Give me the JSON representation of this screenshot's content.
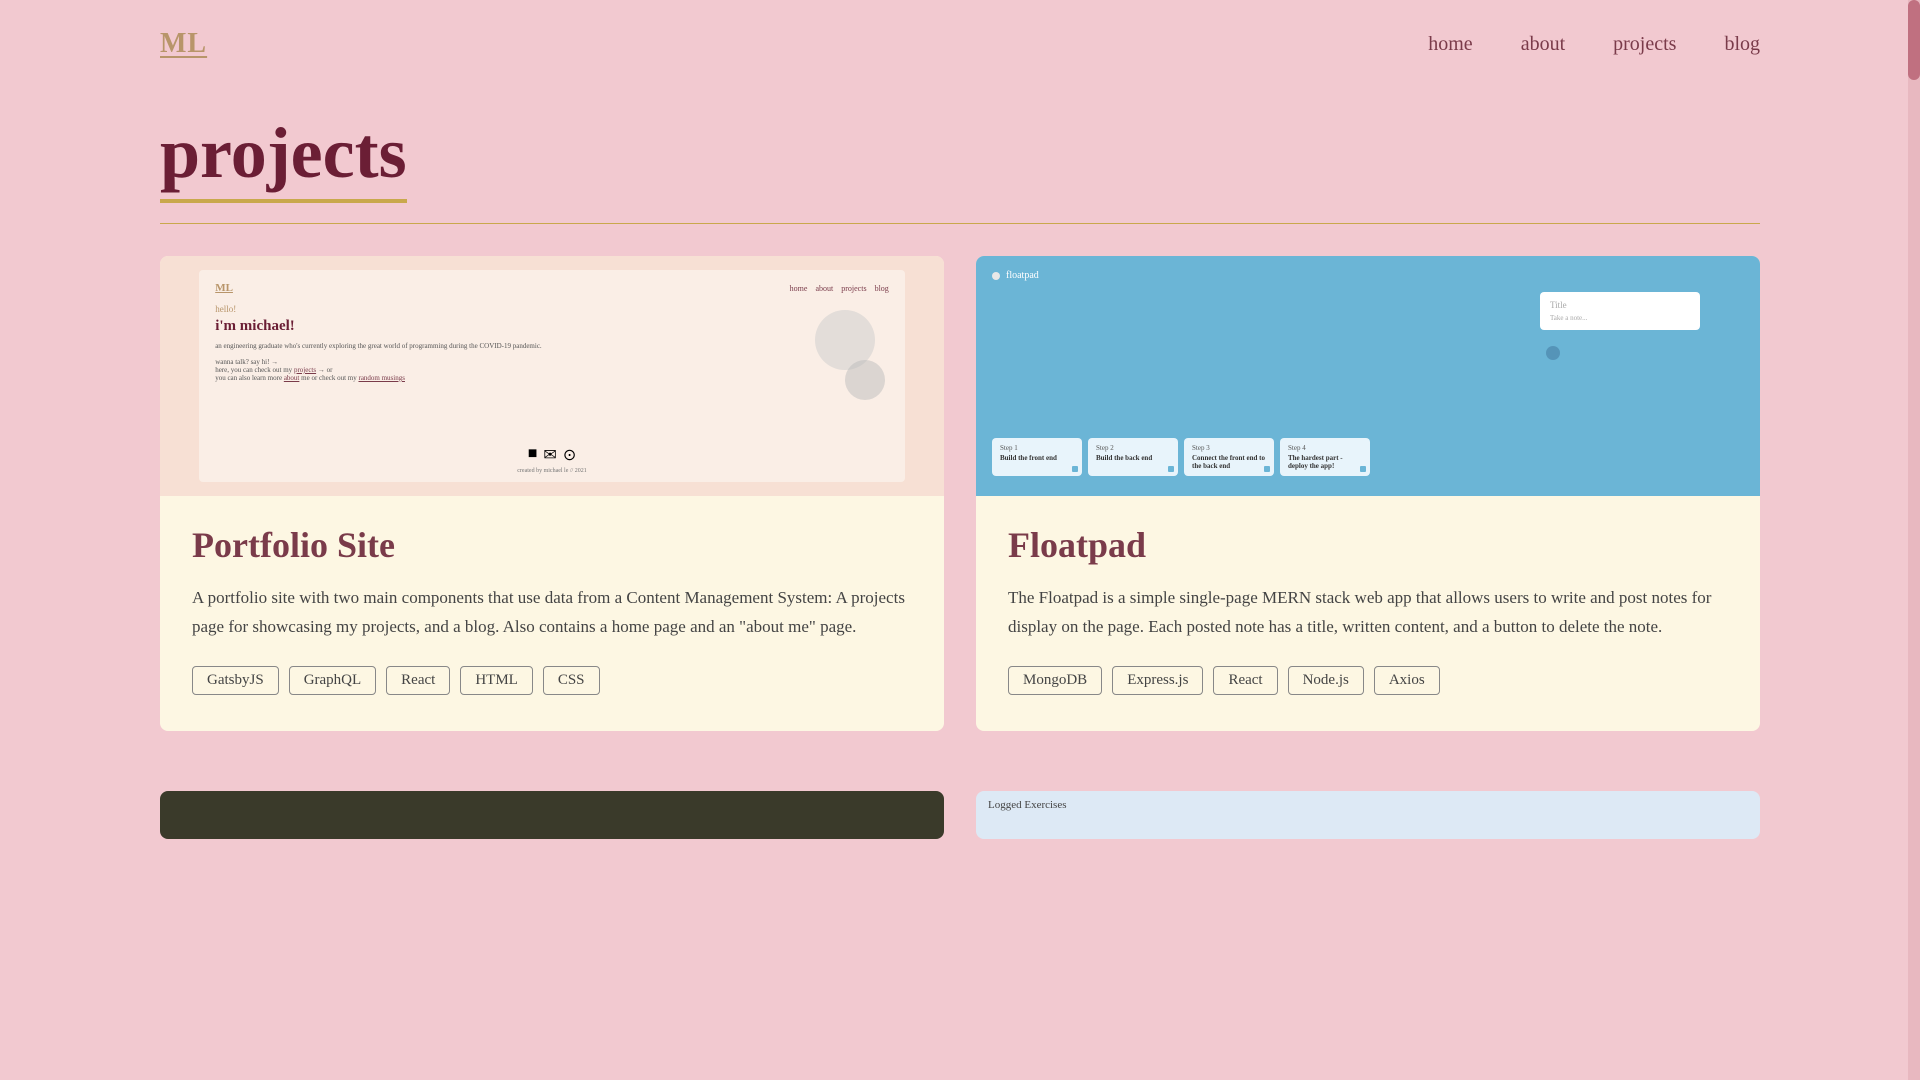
{
  "logo": "ML",
  "nav": {
    "home": "home",
    "about": "about",
    "projects": "projects",
    "blog": "blog"
  },
  "page_title": "projects",
  "projects": [
    {
      "id": "portfolio-site",
      "title": "Portfolio Site",
      "description": "A portfolio site with two main components that use data from a Content Management System: A projects page for showcasing my projects, and a blog. Also contains a home page and an \"about me\" page.",
      "tags": [
        "GatsbyJS",
        "GraphQL",
        "React",
        "HTML",
        "CSS"
      ],
      "thumbnail_type": "portfolio"
    },
    {
      "id": "floatpad",
      "title": "Floatpad",
      "description": "The Floatpad is a simple single-page MERN stack web app that allows users to write and post notes for display on the page. Each posted note has a title, written content, and a button to delete the note.",
      "tags": [
        "MongoDB",
        "Express.js",
        "React",
        "Node.js",
        "Axios"
      ],
      "thumbnail_type": "floatpad"
    }
  ],
  "floatpad_thumb": {
    "app_name": "floatpad",
    "note_title": "Title",
    "note_placeholder": "Take a note...",
    "steps": [
      {
        "num": "Step 1",
        "text": "Build the front end"
      },
      {
        "num": "Step 2",
        "text": "Build the back end"
      },
      {
        "num": "Step 3",
        "text": "Connect the front end to the back end"
      },
      {
        "num": "Step 4",
        "text": "The hardest part - deploy the app!"
      }
    ]
  },
  "portfolio_thumb": {
    "logo": "ML",
    "nav_links": [
      "home",
      "about",
      "projects",
      "blog"
    ],
    "hello": "hello!",
    "greeting": "i'm michael!",
    "line1": "an engineering graduate who's currently exploring the great world of programming during the COVID-19 pandemic.",
    "line2": "wanna talk? say hi! →",
    "line3": "here, you can check out my projects → or",
    "line4": "you can also learn more about me or check out my random musings",
    "footer": "created by michael le // 2021"
  },
  "bottom_cards": [
    {
      "type": "dark"
    },
    {
      "type": "light",
      "label": "Logged Exercises"
    }
  ]
}
